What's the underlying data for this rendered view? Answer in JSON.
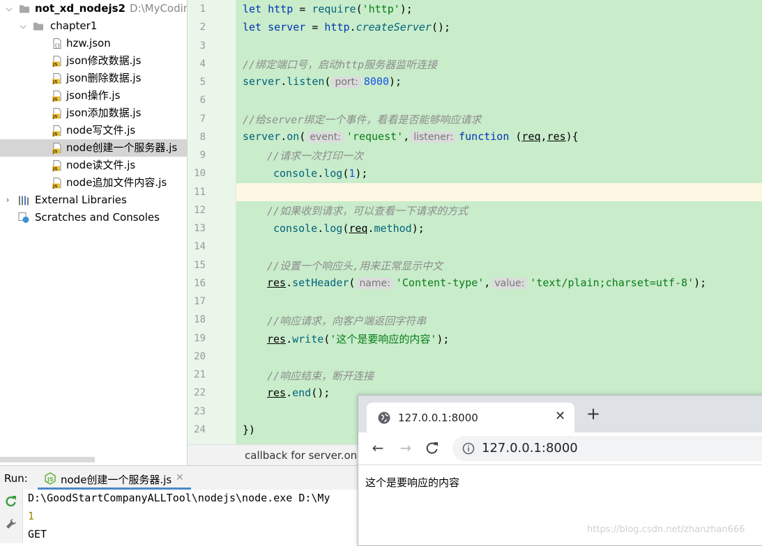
{
  "project": {
    "name": "not_xd_nodejs2",
    "path": "D:\\MyCoding",
    "folder": "chapter1",
    "files": [
      {
        "name": "hzw.json",
        "type": "json"
      },
      {
        "name": "json修改数据.js",
        "type": "js"
      },
      {
        "name": "json删除数据.js",
        "type": "js"
      },
      {
        "name": "json操作.js",
        "type": "js"
      },
      {
        "name": "json添加数据.js",
        "type": "js"
      },
      {
        "name": "node写文件.js",
        "type": "js"
      },
      {
        "name": "node创建一个服务器.js",
        "type": "js",
        "selected": true
      },
      {
        "name": "node读文件.js",
        "type": "js"
      },
      {
        "name": "node追加文件内容.js",
        "type": "js"
      }
    ],
    "external_libraries": "External Libraries",
    "scratches": "Scratches and Consoles"
  },
  "editor": {
    "line_numbers": [
      "1",
      "2",
      "3",
      "4",
      "5",
      "6",
      "7",
      "8",
      "9",
      "10",
      "11",
      "12",
      "13",
      "14",
      "15",
      "16",
      "17",
      "18",
      "19",
      "20",
      "21",
      "22",
      "23",
      "24"
    ],
    "current_line": "11",
    "breadcrumb": "callback for server.on()",
    "code": {
      "l1": {
        "kw1": "let",
        "v": "http",
        "eq": " = ",
        "fn": "require",
        "p1": "(",
        "s": "'http'",
        "p2": ");"
      },
      "l2": {
        "kw1": "let",
        "v": "server",
        "eq": " = ",
        "obj": "http",
        "dot": ".",
        "fn": "createServer",
        "p": "();"
      },
      "l4": "//绑定端口号，启动http服务器监听连接",
      "l5": {
        "obj": "server",
        "dot": ".",
        "fn": "listen",
        "p1": "(",
        "hint": "port:",
        "num": "8000",
        "p2": ");"
      },
      "l7": "//给server绑定一个事件，看看是否能够响应请求",
      "l8": {
        "obj": "server",
        "dot": ".",
        "fn": "on",
        "p1": "(",
        "hint1": "event:",
        "s": "'request'",
        "comma": ",",
        "hint2": "listener:",
        "kw": "function",
        "p2": " (",
        "a1": "req",
        "c2": ",",
        "a2": "res",
        "p3": "){"
      },
      "l9": "//请求一次打印一次",
      "l10": {
        "obj": "console",
        "dot": ".",
        "fn": "log",
        "p1": "(",
        "num": "1",
        "p2": ");"
      },
      "l12": "//如果收到请求，可以查看一下请求的方式",
      "l13": {
        "obj": "console",
        "dot": ".",
        "fn": "log",
        "p1": "(",
        "a": "req",
        "dot2": ".",
        "prop": "method",
        "p2": ");"
      },
      "l15": "//设置一个响应头,用来正常显示中文",
      "l16": {
        "obj": "res",
        "dot": ".",
        "fn": "setHeader",
        "p1": "(",
        "hint1": "name:",
        "s1": "'Content-type'",
        "comma": ",",
        "hint2": "value:",
        "s2": "'text/plain;charset=utf-8'",
        "p2": ");"
      },
      "l18": "//响应请求，向客户端返回字符串",
      "l19": {
        "obj": "res",
        "dot": ".",
        "fn": "write",
        "p1": "(",
        "s": "'这个是要响应的内容'",
        "p2": ");"
      },
      "l21": "//响应结束，断开连接",
      "l22": {
        "obj": "res",
        "dot": ".",
        "fn": "end",
        "p": "();"
      },
      "l24": "})"
    }
  },
  "run": {
    "label": "Run:",
    "tab": "node创建一个服务器.js",
    "console": [
      "D:\\GoodStartCompanyALLTool\\nodejs\\node.exe D:\\My",
      "1",
      "GET"
    ]
  },
  "browser": {
    "tab_title": "127.0.0.1:8000",
    "url": "127.0.0.1:8000",
    "content": "这个是要响应的内容"
  },
  "watermark": "https://blog.csdn.net/zhanzhan666",
  "colors": {
    "code_bg": "#c9eccb",
    "current_line": "#fcf8e3",
    "keyword": "#0033b3",
    "string": "#067d17",
    "number": "#1750eb",
    "comment": "#8c8c8c"
  }
}
